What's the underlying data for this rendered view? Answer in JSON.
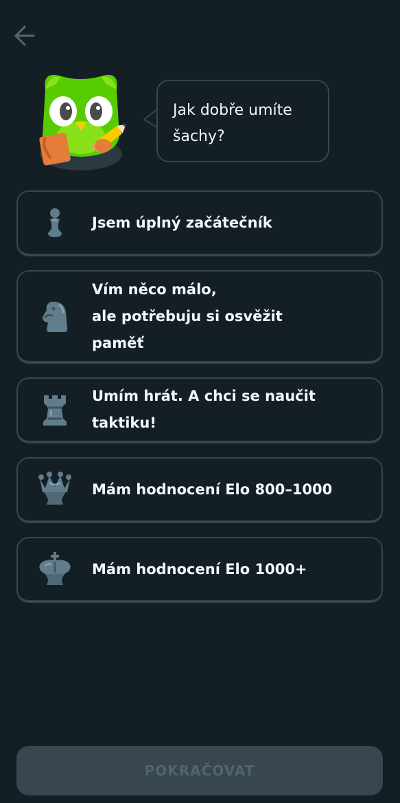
{
  "navigation": {
    "back_icon": "arrow-left-icon"
  },
  "mascot": {
    "name": "duolingo-owl",
    "holding": "pencil-and-notepad"
  },
  "bubble": {
    "text": "Jak dobře umíte\nšachy?"
  },
  "options": [
    {
      "icon": "pawn-icon",
      "label": "Jsem úplný začátečník"
    },
    {
      "icon": "knight-icon",
      "label": "Vím něco málo,\nale potřebuju si osvěžit\npaměť"
    },
    {
      "icon": "rook-icon",
      "label": "Umím hrát. A chci se naučit\ntaktiku!"
    },
    {
      "icon": "queen-icon",
      "label": "Mám hodnocení Elo 800–1000"
    },
    {
      "icon": "king-icon",
      "label": "Mám hodnocení Elo 1000+"
    }
  ],
  "continue_button": {
    "label": "POKRAČOVAT",
    "enabled": false
  },
  "colors": {
    "background": "#131f24",
    "border": "#37464f",
    "text": "#f1f7fb",
    "piece": "#607d8b",
    "disabled_button": "#37464f",
    "disabled_text": "#52656d",
    "owl_green": "#58cc02"
  }
}
